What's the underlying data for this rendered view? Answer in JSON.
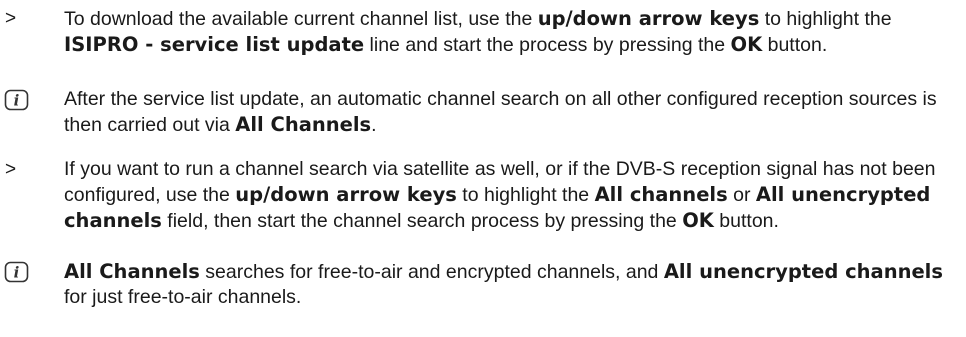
{
  "paragraphs": [
    {
      "type": "arrow",
      "marker": ">",
      "icon": "arrow-marker",
      "segments": [
        {
          "t": "To download the available current channel list, use the "
        },
        {
          "t": "up/down arrow keys",
          "b": true
        },
        {
          "t": " to highlight the "
        },
        {
          "t": "ISIPRO - service list update",
          "b": true
        },
        {
          "t": " line and start the process by pressing the "
        },
        {
          "t": "OK",
          "b": true
        },
        {
          "t": " button."
        }
      ]
    },
    {
      "type": "info",
      "icon": "info-icon",
      "segments": [
        {
          "t": "After the service list update, an automatic channel search on all other configured reception sources is then carried out via "
        },
        {
          "t": "All Channels",
          "b": true
        },
        {
          "t": "."
        }
      ]
    },
    {
      "type": "arrow",
      "marker": ">",
      "icon": "arrow-marker",
      "segments": [
        {
          "t": "If you want to run a channel search via satellite as well, or if the DVB-S reception signal has not been configured, use the "
        },
        {
          "t": "up/down arrow keys",
          "b": true
        },
        {
          "t": " to highlight the "
        },
        {
          "t": "All channels",
          "b": true
        },
        {
          "t": " or "
        },
        {
          "t": "All unencrypted channels",
          "b": true
        },
        {
          "t": " field, then start the channel search process by pressing the "
        },
        {
          "t": "OK",
          "b": true
        },
        {
          "t": " button."
        }
      ]
    },
    {
      "type": "info",
      "icon": "info-icon",
      "segments": [
        {
          "t": "All Channels",
          "b": true
        },
        {
          "t": " searches for free-to-air and encrypted channels, and "
        },
        {
          "t": "All unencrypted channels",
          "b": true
        },
        {
          "t": " for just free-to-air channels."
        }
      ]
    }
  ]
}
